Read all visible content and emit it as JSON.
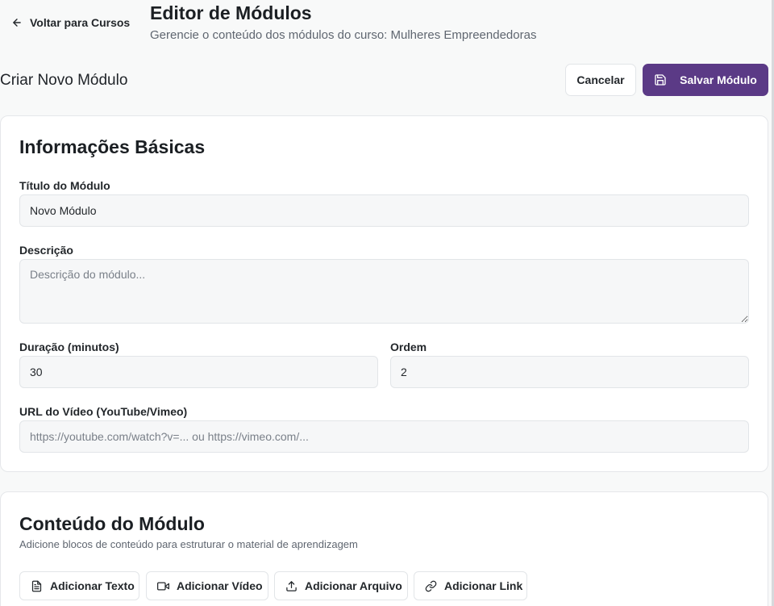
{
  "header": {
    "back_label": "Voltar para Cursos",
    "title": "Editor de Módulos",
    "subtitle": "Gerencie o conteúdo dos módulos do curso: Mulheres Empreendedoras"
  },
  "toolbar": {
    "section_title": "Criar Novo Módulo",
    "cancel_label": "Cancelar",
    "save_label": "Salvar Módulo"
  },
  "basic_info": {
    "heading": "Informações Básicas",
    "title_label": "Título do Módulo",
    "title_value": "Novo Módulo",
    "description_label": "Descrição",
    "description_placeholder": "Descrição do módulo...",
    "duration_label": "Duração (minutos)",
    "duration_value": "30",
    "order_label": "Ordem",
    "order_value": "2",
    "video_label": "URL do Vídeo (YouTube/Vimeo)",
    "video_placeholder": "https://youtube.com/watch?v=... ou https://vimeo.com/..."
  },
  "content": {
    "heading": "Conteúdo do Módulo",
    "description": "Adicione blocos de conteúdo para estruturar o material de aprendizagem",
    "buttons": [
      {
        "label": "Adicionar Texto",
        "icon": "file-text-icon"
      },
      {
        "label": "Adicionar Vídeo",
        "icon": "video-icon"
      },
      {
        "label": "Adicionar Arquivo",
        "icon": "upload-icon"
      },
      {
        "label": "Adicionar Link",
        "icon": "link-icon"
      }
    ]
  },
  "colors": {
    "primary": "#5b3a86",
    "background": "#f8f9f9",
    "input_background": "#f6f7f8"
  }
}
